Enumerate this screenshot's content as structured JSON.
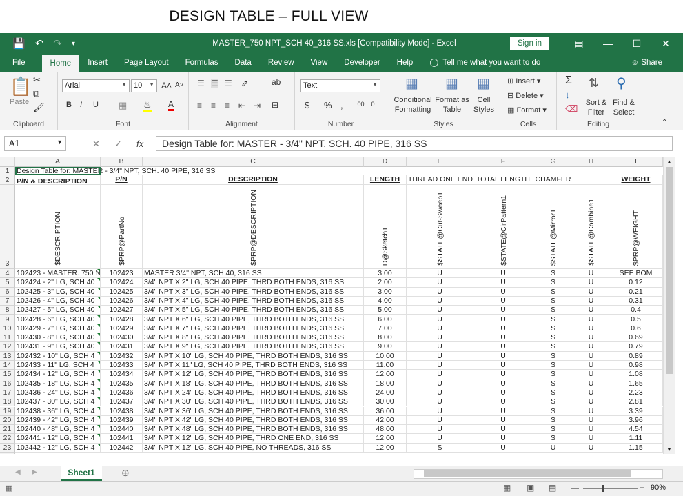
{
  "heading": "DESIGN TABLE – FULL VIEW",
  "window": {
    "title": "MASTER_750 NPT_SCH 40_316 SS.xls  [Compatibility Mode] - Excel",
    "sign_in": "Sign in"
  },
  "tabs": [
    "File",
    "Home",
    "Insert",
    "Page Layout",
    "Formulas",
    "Data",
    "Review",
    "View",
    "Developer",
    "Help"
  ],
  "tell_me": "Tell me what you want to do",
  "share": "Share",
  "ribbon": {
    "paste": "Paste",
    "font_name": "Arial",
    "font_size": "10",
    "number_format": "Text",
    "conditional_formatting": [
      "Conditional",
      "Formatting"
    ],
    "format_as_table": [
      "Format as",
      "Table"
    ],
    "cell_styles": [
      "Cell",
      "Styles"
    ],
    "insert": "Insert",
    "delete": "Delete",
    "format": "Format",
    "sort_filter": [
      "Sort &",
      "Filter"
    ],
    "find_select": [
      "Find &",
      "Select"
    ],
    "groups": [
      "Clipboard",
      "Font",
      "Alignment",
      "Number",
      "Styles",
      "Cells",
      "Editing"
    ]
  },
  "formula_bar": {
    "name_box": "A1",
    "fx": "fx",
    "formula": "Design Table for: MASTER - 3/4\" NPT, SCH. 40 PIPE, 316 SS"
  },
  "sheet": {
    "columns": [
      "A",
      "B",
      "C",
      "D",
      "E",
      "F",
      "G",
      "H",
      "I"
    ],
    "row1": "Design Table for: MASTER - 3/4\" NPT, SCH. 40 PIPE, 316 SS",
    "row2": [
      "P/N & DESCRIPTION",
      "P/N",
      "DESCRIPTION",
      "LENGTH",
      "THREAD ONE END",
      "TOTAL LENGTH",
      "CHAMFER",
      "",
      "WEIGHT"
    ],
    "row3": [
      "$DESCRIPTION",
      "$PRP@PartNo",
      "$PRP@DESCRIPTION",
      "D@Sketch1",
      "$STATE@Cut-Sweep1",
      "$STATE@CirPattern1",
      "$STATE@Mirror1",
      "$STATE@Combine1",
      "$PRP@WEIGHT"
    ],
    "rows": [
      [
        "102423 - MASTER. 750 N",
        "102423",
        "MASTER 3/4\" NPT, SCH 40, 316 SS",
        "3.00",
        "U",
        "U",
        "S",
        "U",
        "SEE BOM"
      ],
      [
        "102424 - 2\" LG, SCH 40",
        "102424",
        "3/4\" NPT X 2\" LG, SCH 40 PIPE, THRD BOTH ENDS, 316 SS",
        "2.00",
        "U",
        "U",
        "S",
        "U",
        "0.12"
      ],
      [
        "102425 - 3\" LG, SCH 40",
        "102425",
        "3/4\" NPT X 3\" LG, SCH 40 PIPE, THRD BOTH ENDS, 316 SS",
        "3.00",
        "U",
        "U",
        "S",
        "U",
        "0.21"
      ],
      [
        "102426 - 4\" LG, SCH 40",
        "102426",
        "3/4\" NPT X 4\" LG, SCH 40 PIPE, THRD BOTH ENDS, 316 SS",
        "4.00",
        "U",
        "U",
        "S",
        "U",
        "0.31"
      ],
      [
        "102427 - 5\" LG, SCH 40",
        "102427",
        "3/4\" NPT X 5\" LG, SCH 40 PIPE, THRD BOTH ENDS, 316 SS",
        "5.00",
        "U",
        "U",
        "S",
        "U",
        "0.4"
      ],
      [
        "102428 - 6\" LG, SCH 40",
        "102428",
        "3/4\" NPT X 6\" LG, SCH 40 PIPE, THRD BOTH ENDS, 316 SS",
        "6.00",
        "U",
        "U",
        "S",
        "U",
        "0.5"
      ],
      [
        "102429 - 7\" LG, SCH 40",
        "102429",
        "3/4\" NPT X 7\" LG, SCH 40 PIPE, THRD BOTH ENDS, 316 SS",
        "7.00",
        "U",
        "U",
        "S",
        "U",
        "0.6"
      ],
      [
        "102430 - 8\" LG, SCH 40",
        "102430",
        "3/4\" NPT X 8\" LG, SCH 40 PIPE, THRD BOTH ENDS, 316 SS",
        "8.00",
        "U",
        "U",
        "S",
        "U",
        "0.69"
      ],
      [
        "102431 - 9\" LG, SCH 40",
        "102431",
        "3/4\" NPT X 9\" LG, SCH 40 PIPE, THRD BOTH ENDS, 316 SS",
        "9.00",
        "U",
        "U",
        "S",
        "U",
        "0.79"
      ],
      [
        "102432 - 10\" LG, SCH 4",
        "102432",
        "3/4\" NPT X 10\" LG, SCH 40 PIPE, THRD BOTH ENDS, 316 SS",
        "10.00",
        "U",
        "U",
        "S",
        "U",
        "0.89"
      ],
      [
        "102433 - 11\" LG, SCH 4",
        "102433",
        "3/4\" NPT X 11\" LG, SCH 40 PIPE, THRD BOTH ENDS, 316 SS",
        "11.00",
        "U",
        "U",
        "S",
        "U",
        "0.98"
      ],
      [
        "102434 - 12\" LG, SCH 4",
        "102434",
        "3/4\" NPT X 12\" LG, SCH 40 PIPE, THRD BOTH ENDS, 316 SS",
        "12.00",
        "U",
        "U",
        "S",
        "U",
        "1.08"
      ],
      [
        "102435 - 18\" LG, SCH 4",
        "102435",
        "3/4\" NPT X 18\" LG, SCH 40 PIPE, THRD BOTH ENDS, 316 SS",
        "18.00",
        "U",
        "U",
        "S",
        "U",
        "1.65"
      ],
      [
        "102436 - 24\" LG, SCH 4",
        "102436",
        "3/4\" NPT X 24\" LG, SCH 40 PIPE, THRD BOTH ENDS, 316 SS",
        "24.00",
        "U",
        "U",
        "S",
        "U",
        "2.23"
      ],
      [
        "102437 - 30\" LG, SCH 4",
        "102437",
        "3/4\" NPT X 30\" LG, SCH 40 PIPE, THRD BOTH ENDS, 316 SS",
        "30.00",
        "U",
        "U",
        "S",
        "U",
        "2.81"
      ],
      [
        "102438 - 36\" LG, SCH 4",
        "102438",
        "3/4\" NPT X 36\" LG, SCH 40 PIPE, THRD BOTH ENDS, 316 SS",
        "36.00",
        "U",
        "U",
        "S",
        "U",
        "3.39"
      ],
      [
        "102439 - 42\" LG, SCH 4",
        "102439",
        "3/4\" NPT X 42\" LG, SCH 40 PIPE, THRD BOTH ENDS, 316 SS",
        "42.00",
        "U",
        "U",
        "S",
        "U",
        "3.96"
      ],
      [
        "102440 - 48\" LG, SCH 4",
        "102440",
        "3/4\" NPT X 48\" LG, SCH 40 PIPE, THRD BOTH ENDS, 316 SS",
        "48.00",
        "U",
        "U",
        "S",
        "U",
        "4.54"
      ],
      [
        "102441 - 12\" LG, SCH 4",
        "102441",
        "3/4\" NPT X 12\" LG, SCH 40 PIPE, THRD ONE END, 316 SS",
        "12.00",
        "U",
        "U",
        "S",
        "U",
        "1.11"
      ],
      [
        "102442 - 12\" LG, SCH 4",
        "102442",
        "3/4\" NPT X 12\" LG, SCH 40 PIPE, NO THREADS, 316 SS",
        "12.00",
        "S",
        "U",
        "U",
        "U",
        "1.15"
      ]
    ]
  },
  "sheet_tab": "Sheet1",
  "zoom": "90%",
  "colors": {
    "excel_green": "#217346",
    "ribbon_bg": "#f3f3f3"
  }
}
